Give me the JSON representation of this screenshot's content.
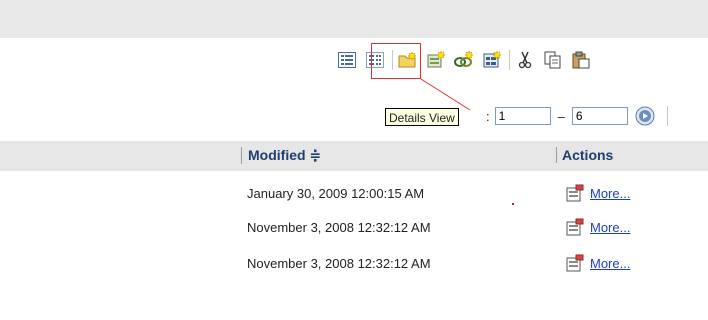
{
  "toolbar": {
    "buttons": [
      {
        "name": "list-view-icon"
      },
      {
        "name": "details-view-icon"
      },
      {
        "name": "new-folder-icon"
      },
      {
        "name": "new-item-icon"
      },
      {
        "name": "new-link-icon"
      },
      {
        "name": "new-page-icon"
      },
      {
        "name": "cut-icon"
      },
      {
        "name": "copy-icon"
      },
      {
        "name": "paste-icon"
      }
    ],
    "tooltip": "Details View"
  },
  "pager": {
    "colon": ":",
    "from": "1",
    "dash": "–",
    "to": "6"
  },
  "table": {
    "columns": {
      "modified": "Modified ≑",
      "actions": "Actions"
    },
    "rows": [
      {
        "modified": "January 30, 2009 12:00:15 AM",
        "action": "More..."
      },
      {
        "modified": "November 3, 2008 12:32:12 AM",
        "action": "More..."
      },
      {
        "modified": "November 3, 2008 12:32:12 AM",
        "action": "More..."
      }
    ]
  },
  "colors": {
    "header_text": "#1c3f6e",
    "link": "#1a3ec8",
    "highlight": "#e03030",
    "tooltip_bg": "#ffffe1"
  }
}
